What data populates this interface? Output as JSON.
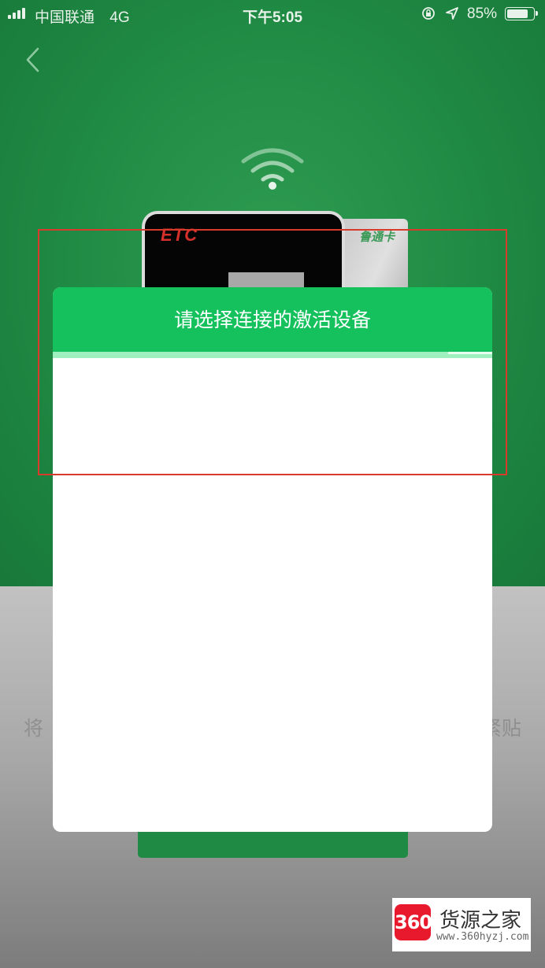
{
  "status_bar": {
    "carrier": "中国联通",
    "network": "4G",
    "time": "下午5:05",
    "battery_percent": "85%",
    "battery_level": 0.85,
    "icons": [
      "signal-icon",
      "orientation-lock-icon",
      "location-arrow-icon",
      "battery-icon"
    ]
  },
  "nav": {
    "back_icon": "chevron-left-icon"
  },
  "illustration": {
    "wifi_icon": "wifi-icon",
    "etc_label": "ETC",
    "card_label": "鲁通卡"
  },
  "instruction": {
    "left_fragment": "将",
    "right_fragment": "紧贴"
  },
  "modal": {
    "title": "请选择连接的激活设备",
    "progress": 0.1,
    "devices": []
  },
  "watermark": {
    "logo_text": "360",
    "name": "货源之家",
    "url": "www.360hyzj.com"
  },
  "colors": {
    "primary_green": "#15c15c",
    "background_green": "#1f8a43",
    "annotation_red": "#d83a2b"
  }
}
